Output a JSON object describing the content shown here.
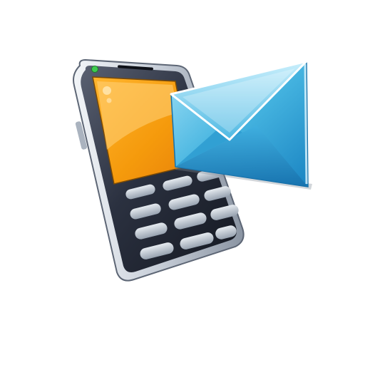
{
  "illustration": {
    "subject": [
      "mobile-phone-icon",
      "mail-envelope-icon"
    ],
    "colors": {
      "background": "#ffffff",
      "phone_body": "#2b3140",
      "phone_bezel": "#c7ced8",
      "screen_orange": "#f59a0c",
      "screen_highlight": "#ffd27a",
      "key": "#b9c2cd",
      "envelope_light": "#7fd0ee",
      "envelope_mid": "#35a9d9",
      "envelope_dark": "#1679b8",
      "status_led": "#3ecb4f"
    }
  }
}
